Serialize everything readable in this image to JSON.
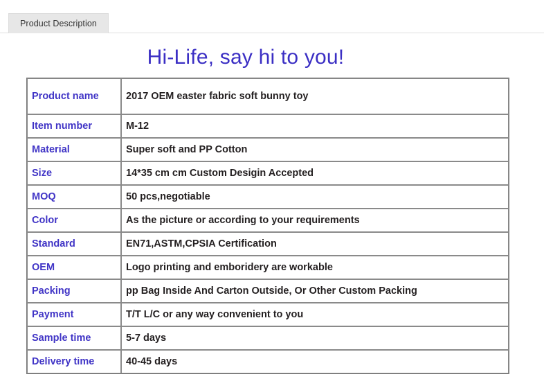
{
  "tabs": [
    {
      "label": "Product Description",
      "active": true
    }
  ],
  "heading": "Hi-Life, say hi to you!",
  "colors": {
    "heading": "#3b2fc4",
    "label_text": "#4034c6",
    "value_text": "#231f20",
    "tab_background": "#e7e7e7",
    "table_border": "#8a8a8a",
    "page_background": "#ffffff"
  },
  "spec_table": {
    "rows": [
      {
        "label": "Product name",
        "value": "2017 OEM easter fabric soft bunny toy"
      },
      {
        "label": "Item number",
        "value": "M-12"
      },
      {
        "label": "Material",
        "value": "Super soft and PP Cotton"
      },
      {
        "label": "Size",
        "value": "14*35 cm cm Custom Desigin Accepted"
      },
      {
        "label": "MOQ",
        "value": "50 pcs,negotiable"
      },
      {
        "label": "Color",
        "value": "As the picture or according to your requirements"
      },
      {
        "label": "Standard",
        "value": "EN71,ASTM,CPSIA Certification"
      },
      {
        "label": "OEM",
        "value": "Logo printing and emboridery are workable"
      },
      {
        "label": "Packing",
        "value": "pp Bag Inside And Carton Outside, Or Other Custom Packing"
      },
      {
        "label": "Payment",
        "value": "T/T L/C or any way convenient to you"
      },
      {
        "label": "Sample time",
        "value": "5-7 days"
      },
      {
        "label": "Delivery time",
        "value": "40-45 days"
      }
    ]
  }
}
